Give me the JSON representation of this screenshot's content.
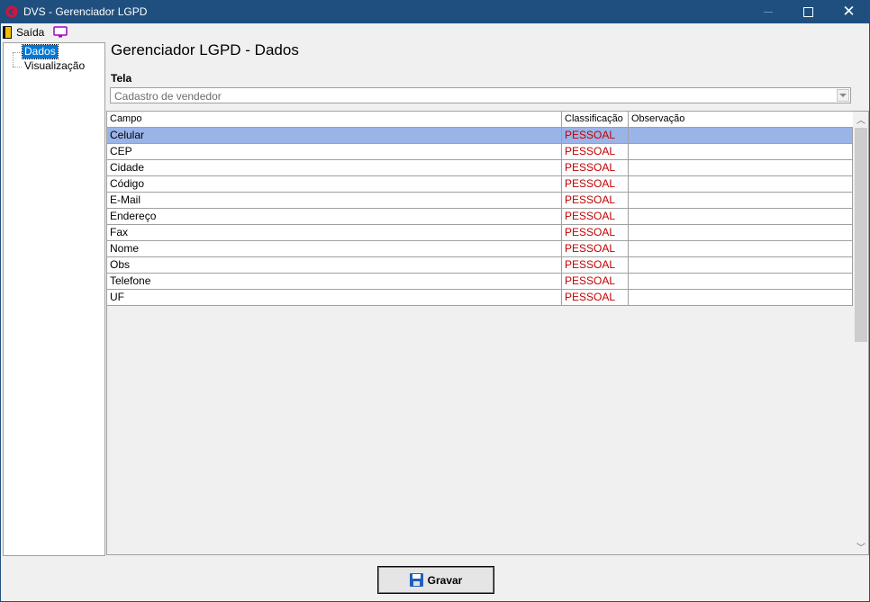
{
  "window": {
    "title": "DVS - Gerenciador LGPD",
    "icon": "dvs-app-icon"
  },
  "menu": {
    "exit_label": "Saída",
    "exit_icon": "door-exit-icon",
    "screen_icon": "monitor-icon"
  },
  "tree": {
    "items": [
      {
        "label": "Dados",
        "selected": true
      },
      {
        "label": "Visualização",
        "selected": false
      }
    ]
  },
  "main": {
    "page_title": "Gerenciador LGPD - Dados",
    "tela_label": "Tela",
    "tela_value": "Cadastro de vendedor"
  },
  "grid": {
    "columns": [
      "Campo",
      "Classificação",
      "Observação"
    ],
    "rows": [
      {
        "campo": "Celular",
        "classificacao": "PESSOAL",
        "observacao": "",
        "selected": true
      },
      {
        "campo": "CEP",
        "classificacao": "PESSOAL",
        "observacao": ""
      },
      {
        "campo": "Cidade",
        "classificacao": "PESSOAL",
        "observacao": ""
      },
      {
        "campo": "Código",
        "classificacao": "PESSOAL",
        "observacao": ""
      },
      {
        "campo": "E-Mail",
        "classificacao": "PESSOAL",
        "observacao": ""
      },
      {
        "campo": "Endereço",
        "classificacao": "PESSOAL",
        "observacao": ""
      },
      {
        "campo": "Fax",
        "classificacao": "PESSOAL",
        "observacao": ""
      },
      {
        "campo": "Nome",
        "classificacao": "PESSOAL",
        "observacao": ""
      },
      {
        "campo": "Obs",
        "classificacao": "PESSOAL",
        "observacao": ""
      },
      {
        "campo": "Telefone",
        "classificacao": "PESSOAL",
        "observacao": ""
      },
      {
        "campo": "UF",
        "classificacao": "PESSOAL",
        "observacao": ""
      }
    ]
  },
  "footer": {
    "save_label": "Gravar",
    "save_icon": "floppy-disk-icon"
  },
  "colors": {
    "titlebar": "#1f4f7f",
    "selection": "#9ab4e8",
    "classification_text": "#c00000",
    "tree_selection": "#0078d7"
  }
}
